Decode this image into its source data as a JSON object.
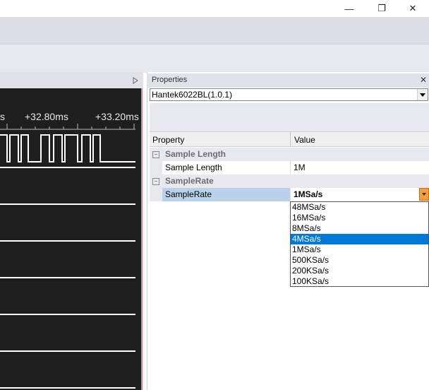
{
  "window": {
    "minimize_glyph": "—",
    "restore_glyph": "❐",
    "close_glyph": "✕"
  },
  "wave": {
    "time_labels": [
      "s",
      "+32.80ms",
      "+33.20ms"
    ],
    "channels": 6
  },
  "properties": {
    "title": "Properties",
    "close_glyph": "✕",
    "device": "Hantek6022BL(1.0.1)",
    "columns": {
      "property": "Property",
      "value": "Value"
    },
    "categories": [
      {
        "name": "Sample Length",
        "items": [
          {
            "name": "Sample Length",
            "value": "1M"
          }
        ]
      },
      {
        "name": "SampleRate",
        "items": [
          {
            "name": "SampleRate",
            "value": "1MSa/s"
          }
        ]
      }
    ],
    "dropdown": {
      "options": [
        "48MSa/s",
        "16MSa/s",
        "8MSa/s",
        "4MSa/s",
        "1MSa/s",
        "500KSa/s",
        "200KSa/s",
        "100KSa/s"
      ],
      "highlighted_index": 3
    }
  },
  "colors": {
    "accent": "#0078d7",
    "scope_bg": "#1e1e1e",
    "dropdown_button": "#f0a040"
  }
}
